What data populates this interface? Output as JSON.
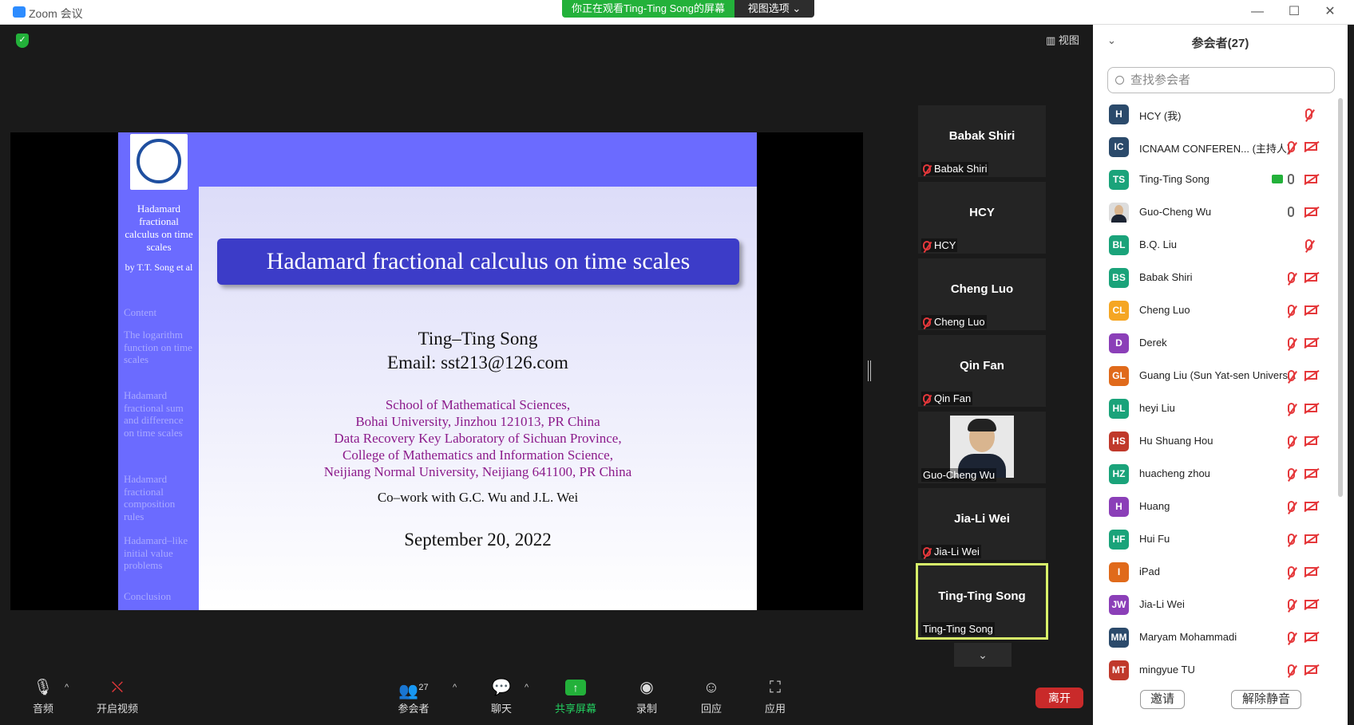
{
  "window": {
    "title": "Zoom 会议",
    "banner": "你正在观看Ting-Ting Song的屏幕",
    "view_options": "视图选项 ⌄",
    "view_button": "视图"
  },
  "slide": {
    "sidebar_title": "Hadamard fractional calculus on time scales",
    "sidebar_author": "by T.T. Song et al",
    "nav": [
      "Content",
      "The logarithm function on time scales",
      "Hadamard fractional sum and difference on time scales",
      "Hadamard fractional composition rules",
      "Hadamard–like initial value problems",
      "Conclusion"
    ],
    "title": "Hadamard fractional calculus on time scales",
    "author": "Ting–Ting Song",
    "email": "Email: sst213@126.com",
    "affiliations": [
      "School of Mathematical Sciences,",
      "Bohai University, Jinzhou 121013, PR China",
      "Data Recovery Key Laboratory of Sichuan Province,",
      "College of Mathematics and Information Science,",
      "Neijiang Normal University, Neijiang 641100, PR China"
    ],
    "cowork": "Co–work with G.C. Wu and J.L. Wei",
    "date": "September 20, 2022"
  },
  "tiles": [
    {
      "name": "Babak Shiri",
      "label": "Babak Shiri",
      "muted": true
    },
    {
      "name": "HCY",
      "label": "HCY",
      "muted": true
    },
    {
      "name": "Cheng Luo",
      "label": "Cheng Luo",
      "muted": true
    },
    {
      "name": "Qin Fan",
      "label": "Qin Fan",
      "muted": true
    },
    {
      "name": "",
      "label": "Guo-Cheng Wu",
      "muted": false,
      "photo": true
    },
    {
      "name": "Jia-Li Wei",
      "label": "Jia-Li Wei",
      "muted": true
    },
    {
      "name": "Ting-Ting Song",
      "label": "Ting-Ting Song",
      "muted": false,
      "active": true
    }
  ],
  "toolbar": {
    "audio": "音频",
    "video": "开启视频",
    "participants": "参会者",
    "participants_count": "27",
    "chat": "聊天",
    "share": "共享屏幕",
    "record": "录制",
    "reactions": "回应",
    "apps": "应用",
    "leave": "离开"
  },
  "panel": {
    "title": "参会者(27)",
    "search_placeholder": "查找参会者",
    "invite": "邀请",
    "unmute": "解除静音",
    "participants": [
      {
        "initials": "H",
        "color": "#2b4a6b",
        "name": "HCY (我)",
        "mic": "off",
        "cam": "none",
        "share": false
      },
      {
        "initials": "IC",
        "color": "#2b4a6b",
        "name": "ICNAAM CONFEREN... (主持人)",
        "mic": "off",
        "cam": "off",
        "share": false
      },
      {
        "initials": "TS",
        "color": "#1aa37a",
        "name": "Ting-Ting Song",
        "mic": "on",
        "cam": "off",
        "share": true
      },
      {
        "initials": "",
        "color": "#ccc",
        "name": "Guo-Cheng Wu",
        "mic": "on",
        "cam": "off",
        "share": false,
        "photo": true
      },
      {
        "initials": "BL",
        "color": "#1aa37a",
        "name": "B.Q. Liu",
        "mic": "off",
        "cam": "none",
        "share": false
      },
      {
        "initials": "BS",
        "color": "#1aa37a",
        "name": "Babak Shiri",
        "mic": "off",
        "cam": "off",
        "share": false
      },
      {
        "initials": "CL",
        "color": "#f5a623",
        "name": "Cheng Luo",
        "mic": "off",
        "cam": "off",
        "share": false
      },
      {
        "initials": "D",
        "color": "#8b3fb8",
        "name": "Derek",
        "mic": "off",
        "cam": "off",
        "share": false
      },
      {
        "initials": "GL",
        "color": "#e06a1b",
        "name": "Guang Liu (Sun Yat-sen Univers...",
        "mic": "off",
        "cam": "off",
        "share": false
      },
      {
        "initials": "HL",
        "color": "#1aa37a",
        "name": "heyi Liu",
        "mic": "off",
        "cam": "off",
        "share": false
      },
      {
        "initials": "HS",
        "color": "#c0392b",
        "name": "Hu Shuang Hou",
        "mic": "off",
        "cam": "off",
        "share": false
      },
      {
        "initials": "HZ",
        "color": "#1aa37a",
        "name": "huacheng zhou",
        "mic": "off",
        "cam": "off",
        "share": false
      },
      {
        "initials": "H",
        "color": "#8b3fb8",
        "name": "Huang",
        "mic": "off",
        "cam": "off",
        "share": false
      },
      {
        "initials": "HF",
        "color": "#1aa37a",
        "name": "Hui Fu",
        "mic": "off",
        "cam": "off",
        "share": false
      },
      {
        "initials": "I",
        "color": "#e06a1b",
        "name": "iPad",
        "mic": "off",
        "cam": "off",
        "share": false
      },
      {
        "initials": "JW",
        "color": "#8b3fb8",
        "name": "Jia-Li Wei",
        "mic": "off",
        "cam": "off",
        "share": false
      },
      {
        "initials": "MM",
        "color": "#2b4a6b",
        "name": "Maryam Mohammadi",
        "mic": "off",
        "cam": "off",
        "share": false
      },
      {
        "initials": "MT",
        "color": "#c0392b",
        "name": "mingyue TU",
        "mic": "off",
        "cam": "off",
        "share": false
      }
    ]
  }
}
